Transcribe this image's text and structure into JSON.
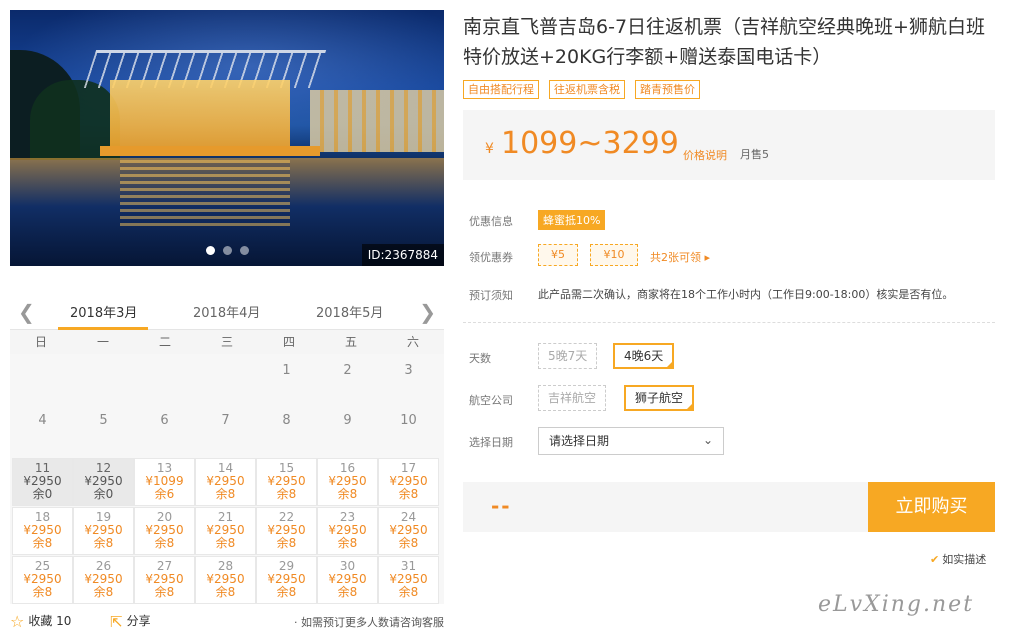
{
  "photo": {
    "id_label": "ID:2367884"
  },
  "calendar": {
    "months": [
      "2018年3月",
      "2018年4月",
      "2018年5月"
    ],
    "weekdays": [
      "日",
      "一",
      "二",
      "三",
      "四",
      "五",
      "六"
    ],
    "plain_row1": [
      "1",
      "2",
      "3"
    ],
    "plain_row2": [
      "4",
      "5",
      "6",
      "7",
      "8",
      "9",
      "10"
    ],
    "rows": [
      [
        {
          "d": "11",
          "p": "¥2950",
          "s": "余0"
        },
        {
          "d": "12",
          "p": "¥2950",
          "s": "余0"
        },
        {
          "d": "13",
          "p": "¥1099",
          "s": "余6"
        },
        {
          "d": "14",
          "p": "¥2950",
          "s": "余8"
        },
        {
          "d": "15",
          "p": "¥2950",
          "s": "余8"
        },
        {
          "d": "16",
          "p": "¥2950",
          "s": "余8"
        },
        {
          "d": "17",
          "p": "¥2950",
          "s": "余8"
        }
      ],
      [
        {
          "d": "18",
          "p": "¥2950",
          "s": "余8"
        },
        {
          "d": "19",
          "p": "¥2950",
          "s": "余8"
        },
        {
          "d": "20",
          "p": "¥2950",
          "s": "余8"
        },
        {
          "d": "21",
          "p": "¥2950",
          "s": "余8"
        },
        {
          "d": "22",
          "p": "¥2950",
          "s": "余8"
        },
        {
          "d": "23",
          "p": "¥2950",
          "s": "余8"
        },
        {
          "d": "24",
          "p": "¥2950",
          "s": "余8"
        }
      ],
      [
        {
          "d": "25",
          "p": "¥2950",
          "s": "余8"
        },
        {
          "d": "26",
          "p": "¥2950",
          "s": "余8"
        },
        {
          "d": "27",
          "p": "¥2950",
          "s": "余8"
        },
        {
          "d": "28",
          "p": "¥2950",
          "s": "余8"
        },
        {
          "d": "29",
          "p": "¥2950",
          "s": "余8"
        },
        {
          "d": "30",
          "p": "¥2950",
          "s": "余8"
        },
        {
          "d": "31",
          "p": "¥2950",
          "s": "余8"
        }
      ]
    ]
  },
  "bottom": {
    "fav_label": "收藏 10",
    "share_label": "分享",
    "tip": "· 如需预订更多人数请咨询客服"
  },
  "product": {
    "title": "南京直飞普吉岛6-7日往返机票（吉祥航空经典晚班+狮航白班特价放送+20KG行李额+赠送泰国电话卡）",
    "tags": [
      "自由搭配行程",
      "往返机票含税",
      "踏青预售价"
    ],
    "currency": "¥",
    "price": "1099~3299",
    "price_explain": "价格说明",
    "monthly_sales": "月售5"
  },
  "info": {
    "discount_label": "优惠信息",
    "discount_badge": "蜂蜜抵10%",
    "coupon_label": "领优惠券",
    "coupons": [
      "¥5",
      "¥10"
    ],
    "coupon_more": "共2张可领 ▸",
    "notice_label": "预订须知",
    "notice_text": "此产品需二次确认，商家将在18个工作小时内（工作日9:00-18:00）核实是否有位。"
  },
  "options": {
    "days_label": "天数",
    "days": [
      "5晚7天",
      "4晚6天"
    ],
    "airline_label": "航空公司",
    "airlines": [
      "吉祥航空",
      "狮子航空"
    ],
    "date_label": "选择日期",
    "date_placeholder": "请选择日期"
  },
  "buy": {
    "total": "--",
    "button": "立即购买",
    "truth": "如实描述"
  },
  "watermark": "eLvXing.net",
  "colors": {
    "accent": "#f7a823",
    "accent_text": "#f08a24"
  }
}
